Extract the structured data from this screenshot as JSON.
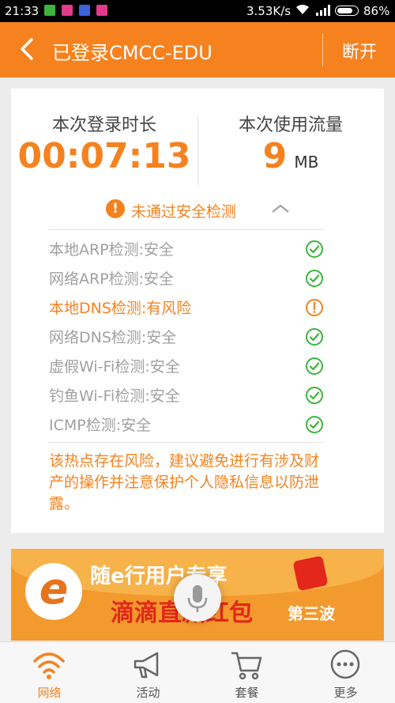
{
  "status_bar": {
    "time": "21:33",
    "network_speed": "3.53K/s",
    "battery_percent": "86%",
    "battery_level": 0.86
  },
  "app_bar": {
    "title": "已登录CMCC-EDU",
    "disconnect_label": "断开"
  },
  "stats": {
    "duration_label": "本次登录时长",
    "duration_value": "00:07:13",
    "traffic_label": "本次使用流量",
    "traffic_value": "9",
    "traffic_unit": "MB"
  },
  "security": {
    "summary": "未通过安全检测",
    "items": [
      {
        "label": "本地ARP检测:安全",
        "status": "safe"
      },
      {
        "label": "网络ARP检测:安全",
        "status": "safe"
      },
      {
        "label": "本地DNS检测:有风险",
        "status": "risk"
      },
      {
        "label": "网络DNS检测:安全",
        "status": "safe"
      },
      {
        "label": "虚假Wi-Fi检测:安全",
        "status": "safe"
      },
      {
        "label": "钓鱼Wi-Fi检测:安全",
        "status": "safe"
      },
      {
        "label": "ICMP检测:安全",
        "status": "safe"
      }
    ],
    "notice": "该热点存在风险，建议避免进行有涉及财产的操作并注意保护个人隐私信息以防泄露。"
  },
  "banner": {
    "line1": "随e行用户专享",
    "line2": "滴滴直减红包",
    "line3": "第三波"
  },
  "bottom_nav": {
    "tabs": [
      {
        "label": "网络",
        "icon": "wifi-icon",
        "active": true
      },
      {
        "label": "活动",
        "icon": "megaphone-icon",
        "active": false
      },
      {
        "label": "套餐",
        "icon": "cart-icon",
        "active": false
      },
      {
        "label": "更多",
        "icon": "more-icon",
        "active": false
      }
    ]
  },
  "colors": {
    "accent": "#f5821f",
    "safe": "#3cb43c",
    "muted_text": "#a0a0a0"
  }
}
